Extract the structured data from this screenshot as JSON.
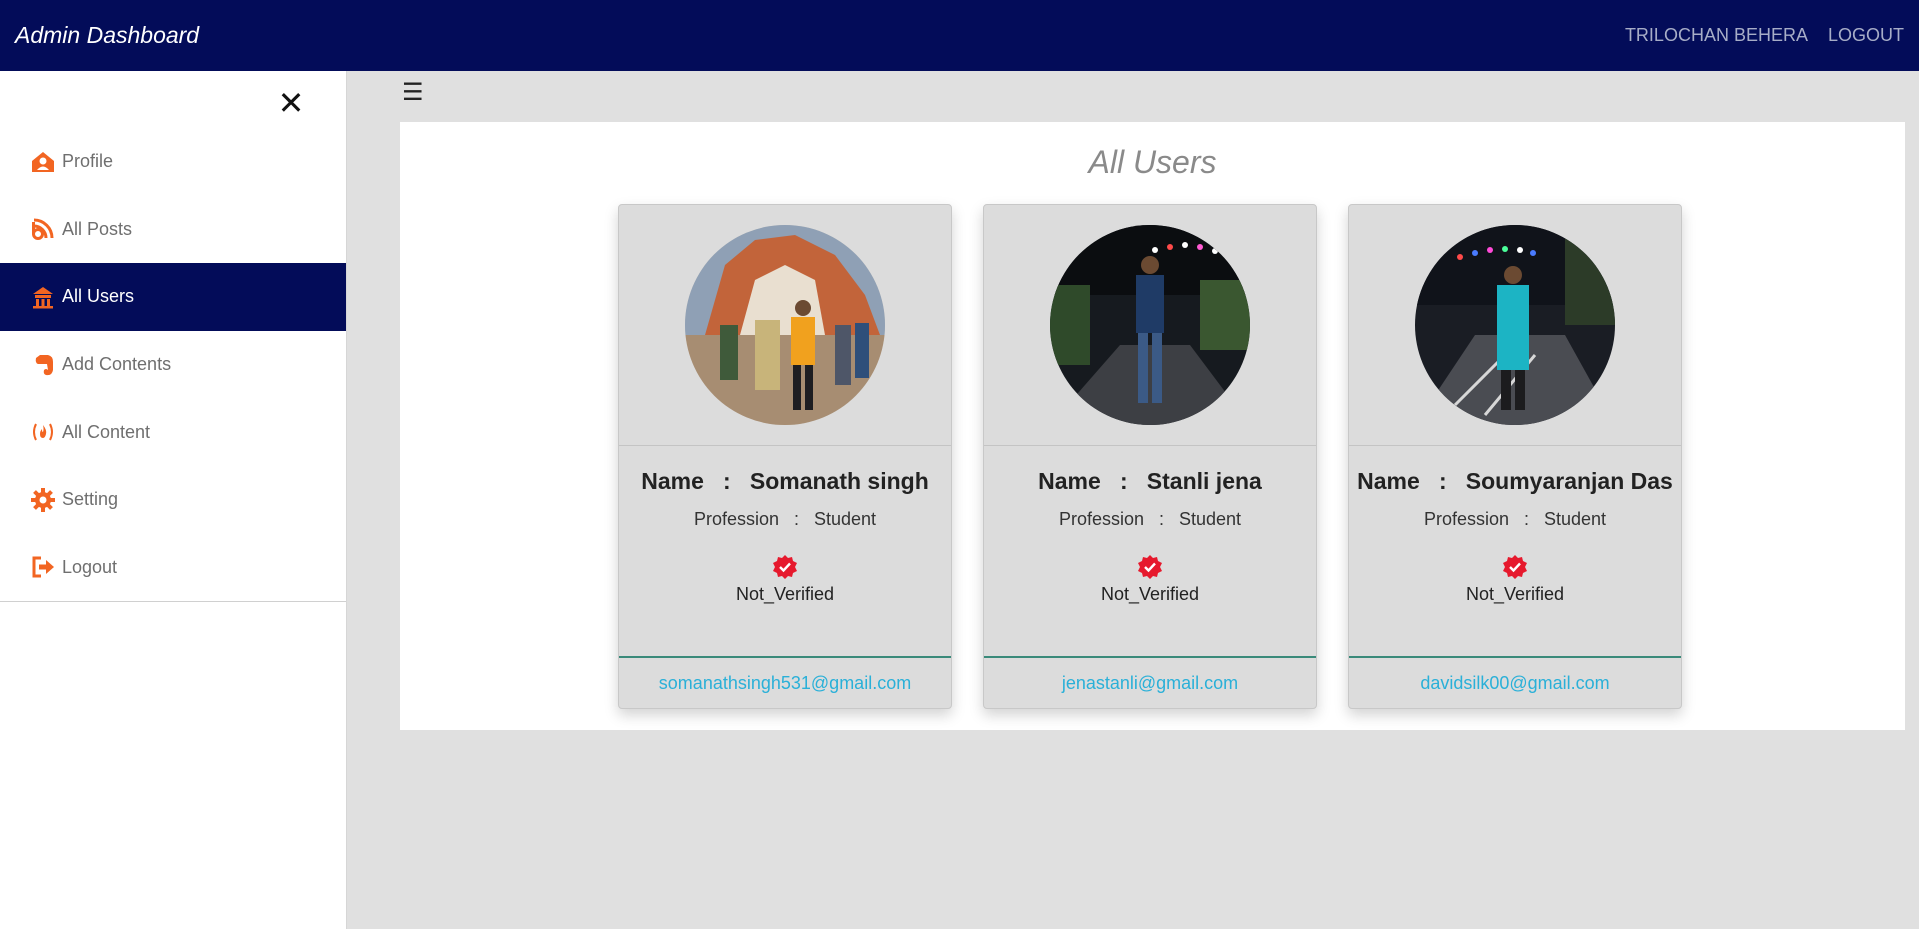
{
  "navbar": {
    "brand": "Admin Dashboard",
    "user_name": "TRILOCHAN BEHERA",
    "logout": "LOGOUT",
    "bg_color": "#030c59"
  },
  "sidebar": {
    "close_icon": "close-icon",
    "accent_color": "#f26522",
    "items": [
      {
        "label": "Profile",
        "icon": "profile-icon",
        "active": false
      },
      {
        "label": "All Posts",
        "icon": "blog-icon",
        "active": false
      },
      {
        "label": "All Users",
        "icon": "users-icon",
        "active": true
      },
      {
        "label": "Add Contents",
        "icon": "evernote-icon",
        "active": false
      },
      {
        "label": "All Content",
        "icon": "fire-icon",
        "active": false
      },
      {
        "label": "Setting",
        "icon": "gear-icon",
        "active": false
      },
      {
        "label": "Logout",
        "icon": "sign-out-icon",
        "active": false
      }
    ]
  },
  "main": {
    "menu_icon": "hamburger-icon",
    "title": "All Users",
    "users": [
      {
        "name": "Name   :   Somanath singh",
        "profession": "Profession   :   Student",
        "status": "Not_Verified",
        "email": "somanathsingh531@gmail.com"
      },
      {
        "name": "Name   :   Stanli jena",
        "profession": "Profession   :   Student",
        "status": "Not_Verified",
        "email": "jenastanli@gmail.com"
      },
      {
        "name": "Name   :   Soumyaranjan Das",
        "profession": "Profession   :   Student",
        "status": "Not_Verified",
        "email": "davidsilk00@gmail.com"
      }
    ]
  },
  "colors": {
    "badge_red": "#e6192d",
    "email_blue": "#2ab0d8",
    "active_bg": "#030c59"
  }
}
